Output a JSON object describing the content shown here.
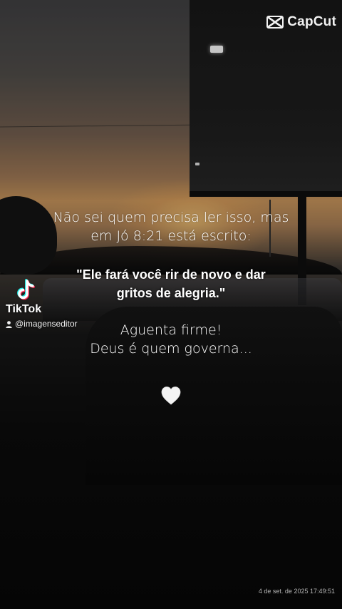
{
  "watermarks": {
    "capcut_label": "CapCut",
    "capcut_icon": "capcut-logo-icon",
    "tiktok_label": "TikTok",
    "tiktok_icon": "tiktok-logo-icon",
    "tiktok_user": "@imagenseditor",
    "user_icon": "person-icon"
  },
  "message": {
    "intro_line1": "Não sei quem precisa ler isso, mas",
    "intro_line2": "em Jó 8:21 está escrito:",
    "verse_line1": "\"Ele fará você rir de novo e dar",
    "verse_line2": "gritos de alegria.\"",
    "closing_line1": "Aguenta firme!",
    "closing_line2": "Deus é quem governa...",
    "heart_icon": "white-heart-icon"
  },
  "timestamp": "4 de set. de 2025 17:49:51",
  "colors": {
    "text": "#ffffff",
    "tiktok_cyan": "#25f4ee",
    "tiktok_red": "#fe2c55"
  }
}
